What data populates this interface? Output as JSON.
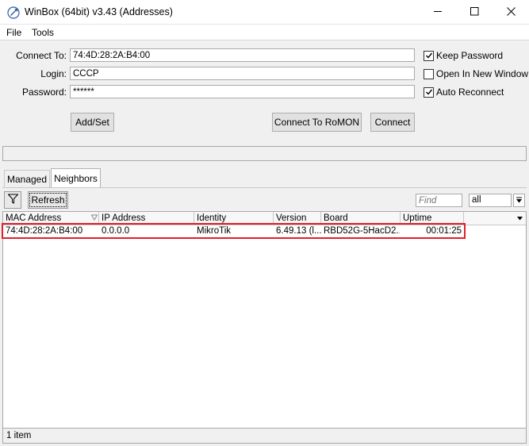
{
  "window": {
    "title": "WinBox (64bit) v3.43 (Addresses)"
  },
  "menu": {
    "items": [
      "File",
      "Tools"
    ]
  },
  "form": {
    "connect_to_label": "Connect To:",
    "connect_to_value": "74:4D:28:2A:B4:00",
    "login_label": "Login:",
    "login_value": "CCCP",
    "password_label": "Password:",
    "password_value": "******",
    "keep_password_label": "Keep Password",
    "keep_password_checked": true,
    "open_new_window_label": "Open In New Window",
    "open_new_window_checked": false,
    "auto_reconnect_label": "Auto Reconnect",
    "auto_reconnect_checked": true,
    "add_set_label": "Add/Set",
    "connect_romon_label": "Connect To RoMON",
    "connect_label": "Connect"
  },
  "tabs": [
    {
      "label": "Managed",
      "active": false
    },
    {
      "label": "Neighbors",
      "active": true
    }
  ],
  "toolbar": {
    "refresh_label": "Refresh",
    "find_placeholder": "Find",
    "filter_value": "all"
  },
  "table": {
    "columns": [
      "MAC Address",
      "IP Address",
      "Identity",
      "Version",
      "Board",
      "Uptime"
    ],
    "rows": [
      {
        "mac": "74:4D:28:2A:B4:00",
        "ip": "0.0.0.0",
        "identity": "MikroTik",
        "version": "6.49.13 (l...",
        "board": "RBD52G-5HacD2...",
        "uptime": "00:01:25"
      }
    ]
  },
  "status": {
    "count_text": "1 item"
  },
  "colors": {
    "highlight": "#e0202a",
    "accent": "#1a6fc4"
  }
}
